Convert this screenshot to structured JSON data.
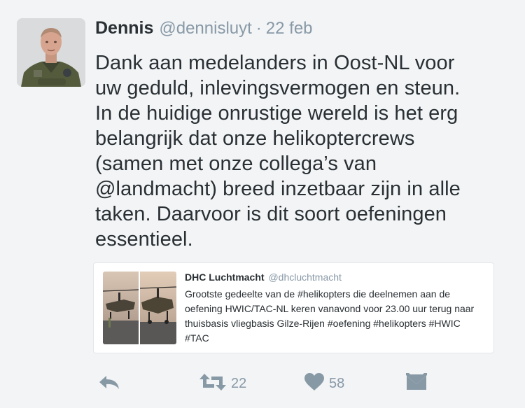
{
  "tweet": {
    "author_name": "Dennis",
    "author_handle": "@dennisluyt",
    "separator": "·",
    "date": "22 feb",
    "text_lines": [
      "Dank aan medelanders in Oost-NL voor",
      "uw geduld, inlevingsvermogen en steun.",
      "In de huidige onrustige wereld is het erg",
      "belangrijk dat onze helikoptercrews",
      "(samen met onze collega’s van",
      "@landmacht) breed inzetbaar zijn in alle",
      "taken. Daarvoor is dit soort oefeningen",
      "essentieel."
    ]
  },
  "quoted_tweet": {
    "author_name": "DHC Luchtmacht",
    "author_handle": "@dhcluchtmacht",
    "text_lines": [
      "Grootste gedeelte van de #helikopters die deelnemen aan de",
      "oefening HWIC/TAC-NL keren vanavond voor 23.00 uur terug naar",
      "thuisbasis vliegbasis Gilze-Rijen #oefening #helikopters #HWIC",
      "#TAC"
    ]
  },
  "actions": {
    "retweet_count": "22",
    "like_count": "58"
  },
  "icons": [
    "reply-icon",
    "retweet-icon",
    "like-icon",
    "message-icon"
  ],
  "colors": {
    "muted": "#8899a6",
    "text": "#292f33",
    "background": "#f2f4f6"
  }
}
